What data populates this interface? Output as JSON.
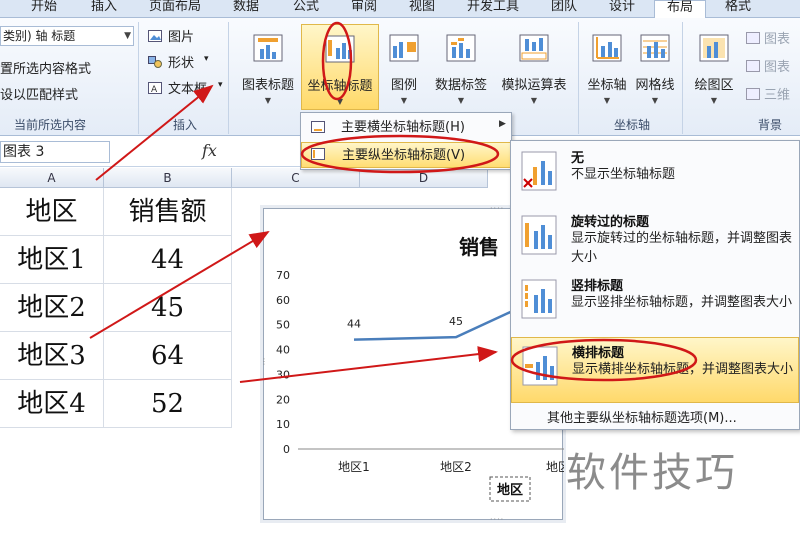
{
  "tabs": [
    "开始",
    "插入",
    "页面布局",
    "数据",
    "公式",
    "审阅",
    "视图",
    "开发工具",
    "团队",
    "设计",
    "布局",
    "格式"
  ],
  "ribbon": {
    "current_selection": {
      "combo_value": "类别) 轴 标题",
      "format_selection": "置所选内容格式",
      "reset_style": "设以匹配样式",
      "group_label": "当前所选内容"
    },
    "insert": {
      "picture": "图片",
      "shapes": "形状",
      "textbox": "文本框",
      "group_label": "插入"
    },
    "labels": {
      "chart_title": "图表标题",
      "axis_titles": "坐标轴标题",
      "legend": "图例",
      "data_labels": "数据标签",
      "data_table": "模拟运算表"
    },
    "axes": {
      "axes": "坐标轴",
      "gridlines": "网格线",
      "group_label": "坐标轴"
    },
    "background": {
      "plot_area": "绘图区",
      "chart_wall": "图表",
      "chart_floor": "图表",
      "rotation_3d": "三维",
      "group_label": "背景"
    }
  },
  "formula_bar": {
    "name_box": "图表 3",
    "fx_label": "fx"
  },
  "sheet": {
    "columns": [
      "A",
      "B",
      "C",
      "D"
    ],
    "rows": [
      [
        "地区",
        "销售额"
      ],
      [
        "地区1",
        "44"
      ],
      [
        "地区2",
        "45"
      ],
      [
        "地区3",
        "64"
      ],
      [
        "地区4",
        "52"
      ]
    ]
  },
  "chart_data": {
    "type": "line",
    "title": "销售",
    "categories": [
      "地区1",
      "地区2",
      "地区3",
      "地区4"
    ],
    "values": [
      44,
      45,
      64,
      52
    ],
    "data_labels": [
      "44",
      "45"
    ],
    "visible_category_labels": [
      "地区1",
      "地区2",
      "地区"
    ],
    "y_ticks": [
      "0",
      "10",
      "20",
      "30",
      "40",
      "50",
      "60",
      "70"
    ],
    "ylim": [
      0,
      70
    ],
    "xlabel": "地区",
    "line_color": "#4a7ebb",
    "grid": false
  },
  "axis_menu": {
    "horizontal": "主要横坐标轴标题(H)",
    "vertical": "主要纵坐标轴标题(V)"
  },
  "vertical_options": [
    {
      "title": "无",
      "desc": "不显示坐标轴标题"
    },
    {
      "title": "旋转过的标题",
      "desc": "显示旋转过的坐标轴标题，并调整图表大小"
    },
    {
      "title": "竖排标题",
      "desc": "显示竖排坐标轴标题，并调整图表大小"
    },
    {
      "title": "横排标题",
      "desc": "显示横排坐标轴标题，并调整图表大小"
    }
  ],
  "more_options": "其他主要纵坐标轴标题选项(M)...",
  "watermark": "软件技巧",
  "colors": {
    "highlight": "#ffd969",
    "annotation": "#d01818",
    "ribbon_bg": "#e4ecf7"
  }
}
